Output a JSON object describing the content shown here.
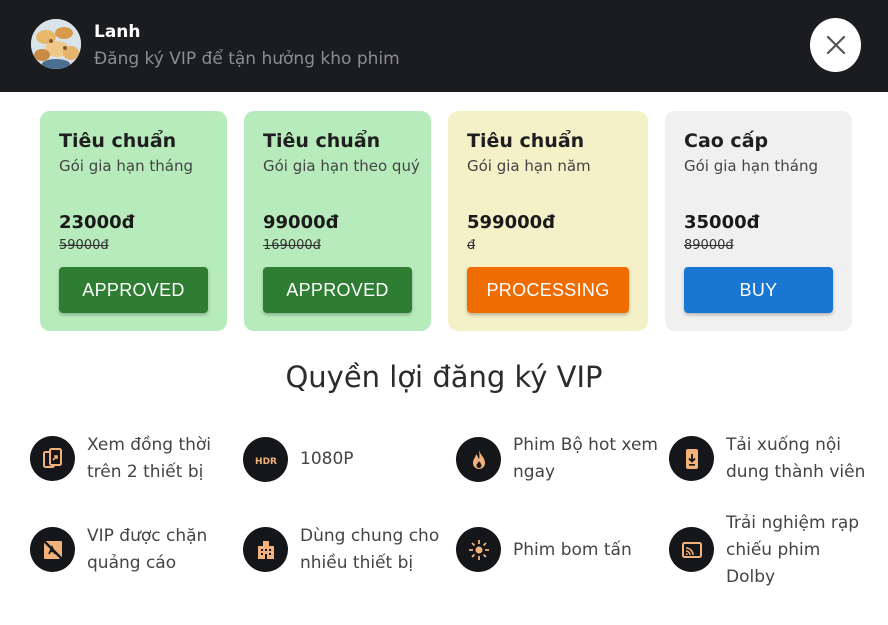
{
  "header": {
    "user_name": "Lanh",
    "subtitle": "Đăng ký VIP để tận hưởng kho phim"
  },
  "plans": [
    {
      "title": "Tiêu chuẩn",
      "subtitle": "Gói gia hạn tháng",
      "price": "23000đ",
      "old_price": "59000đ",
      "button": "APPROVED",
      "bg": "#b7ebbb",
      "btn_color": "#2e7d32"
    },
    {
      "title": "Tiêu chuẩn",
      "subtitle": "Gói gia hạn theo quý",
      "price": "99000đ",
      "old_price": "169000đ",
      "button": "APPROVED",
      "bg": "#b7ebbb",
      "btn_color": "#2e7d32"
    },
    {
      "title": "Tiêu chuẩn",
      "subtitle": "Gói gia hạn năm",
      "price": "599000đ",
      "old_price": "đ",
      "button": "PROCESSING",
      "bg": "#f4f0c8",
      "btn_color": "#ef6c00"
    },
    {
      "title": "Cao cấp",
      "subtitle": "Gói gia hạn tháng",
      "price": "35000đ",
      "old_price": "89000đ",
      "button": "BUY",
      "bg": "#f0f0f0",
      "btn_color": "#1976d2"
    }
  ],
  "benefits_title": "Quyền lợi đăng ký VIP",
  "benefits": [
    {
      "label_lines": [
        "Xem đồng thời",
        "trên 2 thiết bị"
      ],
      "icon": "devices-icon"
    },
    {
      "label_lines": [
        "1080P"
      ],
      "icon": "hdr-icon"
    },
    {
      "label_lines": [
        "Phim Bộ hot xem",
        "ngay"
      ],
      "icon": "fire-icon"
    },
    {
      "label_lines": [
        "Tải xuống nội",
        "dung thành viên"
      ],
      "icon": "download-icon"
    },
    {
      "label_lines": [
        "VIP được chặn",
        "quảng cáo"
      ],
      "icon": "ad-block-icon"
    },
    {
      "label_lines": [
        "Dùng chung cho",
        "nhiều thiết bị"
      ],
      "icon": "building-icon"
    },
    {
      "label_lines": [
        "Phim bom tấn"
      ],
      "icon": "sparkle-icon"
    },
    {
      "label_lines": [
        "Trải nghiệm rạp",
        "chiếu phim",
        "Dolby"
      ],
      "icon": "cast-icon"
    }
  ],
  "colors": {
    "header_bg": "#1b1c20",
    "icon_accent": "#f2b27a"
  }
}
